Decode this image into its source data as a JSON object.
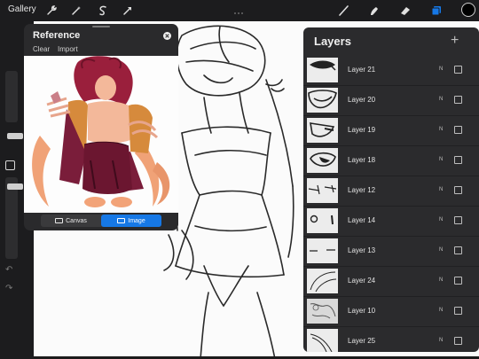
{
  "topbar": {
    "gallery_label": "Gallery",
    "tools": [
      "wrench-icon",
      "magic-wand-icon",
      "selection-icon",
      "transform-arrow-icon"
    ],
    "drawing_tools": [
      "brush-icon",
      "smudge-icon",
      "eraser-icon",
      "layers-icon"
    ],
    "active_color": "#000000",
    "accent": "#1678e6"
  },
  "reference": {
    "title": "Reference",
    "clear_label": "Clear",
    "import_label": "Import",
    "canvas_label": "Canvas",
    "image_label": "Image",
    "selected": "Image"
  },
  "layers": {
    "title": "Layers",
    "items": [
      {
        "name": "Layer 21",
        "blend": "N"
      },
      {
        "name": "Layer 20",
        "blend": "N"
      },
      {
        "name": "Layer 19",
        "blend": "N"
      },
      {
        "name": "Layer 18",
        "blend": "N"
      },
      {
        "name": "Layer 12",
        "blend": "N"
      },
      {
        "name": "Layer 14",
        "blend": "N"
      },
      {
        "name": "Layer 13",
        "blend": "N"
      },
      {
        "name": "Layer 24",
        "blend": "N"
      },
      {
        "name": "Layer 10",
        "blend": "N"
      },
      {
        "name": "Layer 25",
        "blend": "N"
      }
    ]
  }
}
